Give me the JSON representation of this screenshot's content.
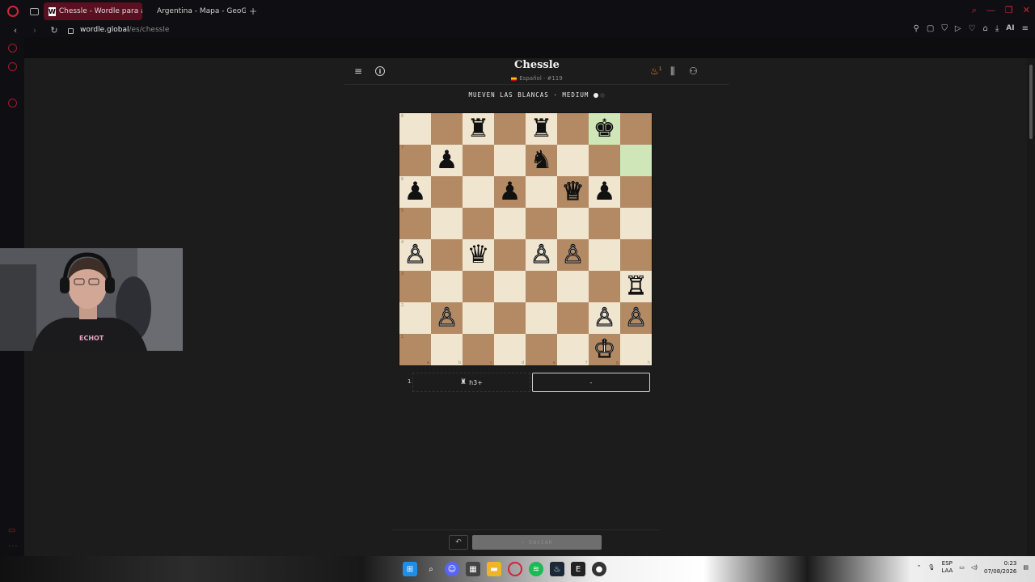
{
  "browser": {
    "tabs": [
      {
        "title": "Chessle - Wordle para ajec",
        "active": true
      },
      {
        "title": "Argentina - Mapa - GeoGu",
        "active": false
      }
    ],
    "url_host": "wordle.global",
    "url_path": "/es/chessle",
    "ai_label": "AI"
  },
  "app": {
    "title": "Chessle",
    "language": "Español",
    "puzzle_number": "#119",
    "streak_count": "1",
    "turn_text": "MUEVEN LAS BLANCAS",
    "difficulty": "MEDIUM",
    "accent_color": "#f08a24"
  },
  "board": {
    "ranks": [
      [
        "",
        "",
        "♜",
        "",
        "♜",
        "",
        "♚",
        ""
      ],
      [
        "",
        "♟",
        "",
        "",
        "♞",
        "",
        "",
        ""
      ],
      [
        "♟",
        "",
        "",
        "♟",
        "",
        "♕",
        "♟",
        ""
      ],
      [
        "",
        "",
        "",
        "",
        "",
        "",
        "",
        ""
      ],
      [
        "♙",
        "",
        "♛",
        "",
        "♙",
        "♙",
        "",
        ""
      ],
      [
        "",
        "",
        "",
        "",
        "",
        "",
        "",
        "♖"
      ],
      [
        "",
        "♙",
        "",
        "",
        "",
        "",
        "♙",
        "♙"
      ],
      [
        "",
        "",
        "",
        "",
        "",
        "",
        "♔",
        ""
      ]
    ],
    "highlighted": [
      "g8",
      "h7"
    ],
    "rank_labels": [
      "8",
      "7",
      "6",
      "5",
      "4",
      "3",
      "2",
      "1"
    ],
    "file_labels": [
      "a",
      "b",
      "c",
      "d",
      "e",
      "f",
      "g",
      "h"
    ]
  },
  "moves": {
    "number": "1",
    "played": "h3+",
    "played_piece": "♜",
    "input_value": "-"
  },
  "footer": {
    "undo_icon": "↶",
    "submit_label": "✓ ENVIAR"
  },
  "taskbar": {
    "lang_top": "ESP",
    "lang_bottom": "LAA",
    "time": "0:23",
    "date": "07/08/2026"
  }
}
